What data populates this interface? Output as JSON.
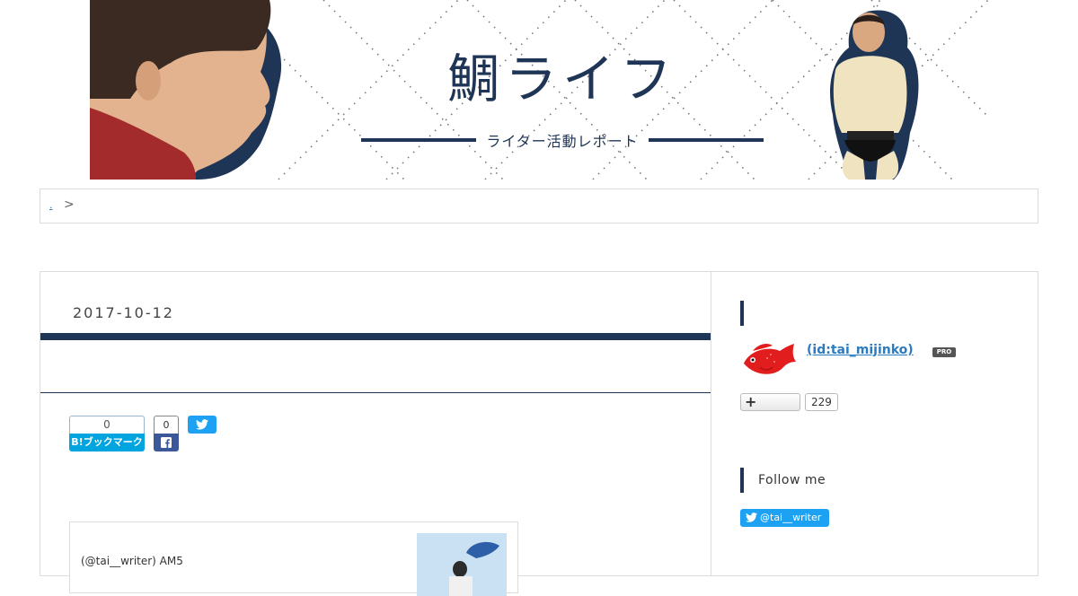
{
  "header": {
    "site_title": "鯛ライフ",
    "site_subtitle": "ライター活動レポート"
  },
  "breadcrumb": {
    "home_link": ".",
    "separator": ">"
  },
  "entry": {
    "date": "2017-10-12",
    "title": "",
    "lead": "",
    "share": {
      "hatena_count": "0",
      "hatena_label": "B!ブックマーク",
      "facebook_count": "0"
    },
    "embed": {
      "text": "(@tai__writer) AM5"
    }
  },
  "sidebar": {
    "profile": {
      "id_link": "(id:tai_mijinko)",
      "badge": "PRO",
      "follow_plus": "+",
      "follow_count": "229"
    },
    "follow_me": {
      "title": "Follow me",
      "twitter_label": "@tai__writer"
    }
  },
  "colors": {
    "navy": "#1f3556",
    "link": "#2a7bbf",
    "twitter": "#1da1f2",
    "facebook": "#3b5998",
    "hatena": "#00a4de"
  }
}
